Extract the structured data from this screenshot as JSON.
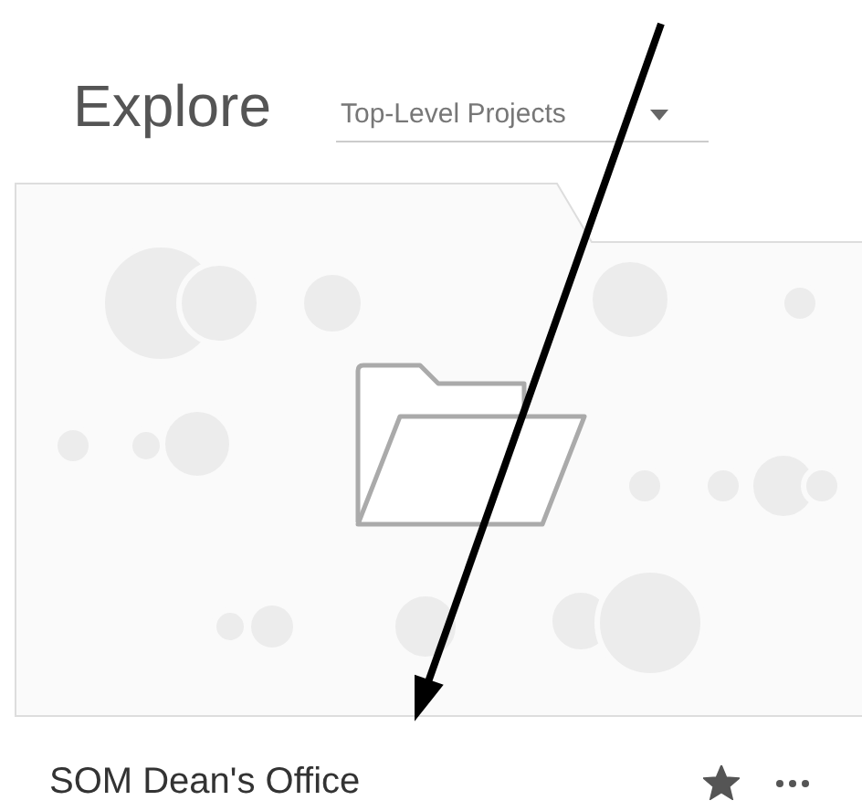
{
  "header": {
    "title": "Explore",
    "filter": {
      "value": "Top-Level Projects"
    }
  },
  "projects": [
    {
      "name": "SOM Dean's Office",
      "kind": "folder",
      "starred": true
    }
  ]
}
